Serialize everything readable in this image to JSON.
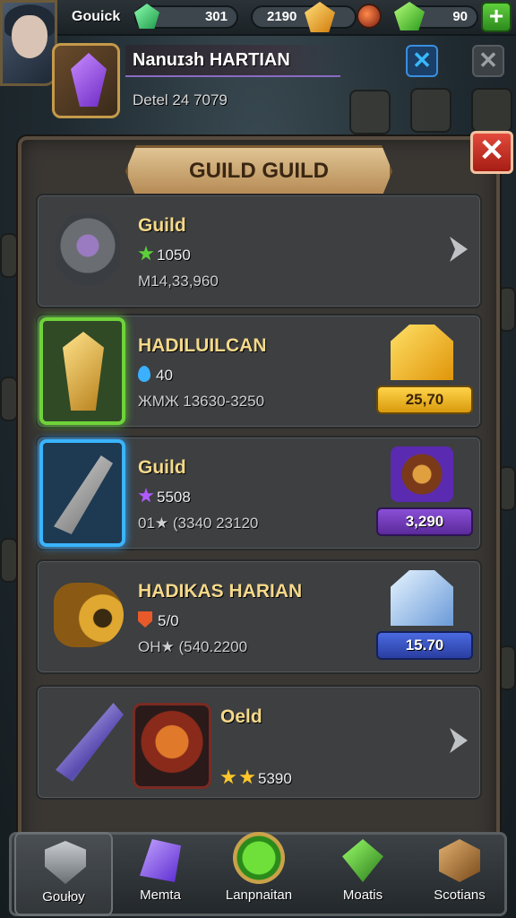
{
  "hud": {
    "title": "Gouick",
    "resources": [
      {
        "name": "green-gem",
        "value": "301",
        "color": "#3ec86a"
      },
      {
        "name": "gold-coin",
        "value": "2190",
        "color": "#f0a820"
      },
      {
        "name": "green-crystal",
        "value": "90",
        "color": "#52d040"
      }
    ],
    "add_label": "+"
  },
  "player": {
    "name": "Nanuɪɜh HARTIAN",
    "subtitle": "Detel 24 7079",
    "blue_button": "✕",
    "grey_button": "✕"
  },
  "panel": {
    "title": "GUILD GUILD",
    "close_label": "✕",
    "rows": [
      {
        "title": "Guild",
        "line2": "1050",
        "line3": "M14,33,960",
        "icon": "stone-golem-icon",
        "action": "arrow"
      },
      {
        "title": "HADILUILCAN",
        "line2": "40",
        "line3": "ЖМЖ 13630-3250",
        "icon": "golden-dagger-icon",
        "price": "25,70",
        "price_style": "gold"
      },
      {
        "title": "Guild",
        "line2": "5508",
        "line3": "01★ (3340 23120",
        "icon": "crossbow-icon",
        "price": "3,290",
        "price_style": "purple"
      },
      {
        "title": "HADIKAS HARIAN",
        "line2": "5/0",
        "line3": "OH★ (540.2200",
        "icon": "golden-cannon-icon",
        "price": "15.70",
        "price_style": "blue"
      },
      {
        "title": "Oeld",
        "line2": "5390",
        "icon": "crystal-sword-icon",
        "action": "arrow"
      }
    ]
  },
  "nav": {
    "items": [
      {
        "label": "Goułoy",
        "icon": "shield-icon"
      },
      {
        "label": "Memta",
        "icon": "purple-gem-icon"
      },
      {
        "label": "Lanpnaitan",
        "icon": "green-arrow-icon"
      },
      {
        "label": "Moatis",
        "icon": "green-diamond-icon"
      },
      {
        "label": "Scotians",
        "icon": "crate-icon"
      }
    ]
  }
}
